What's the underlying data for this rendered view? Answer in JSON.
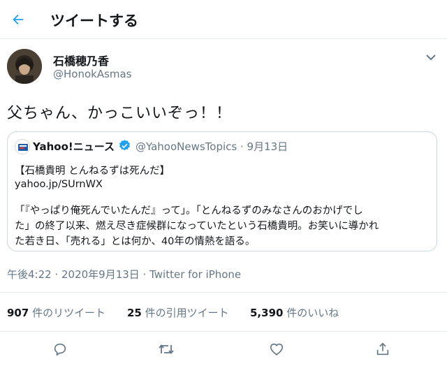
{
  "header": {
    "title": "ツイートする",
    "back_icon": "arrow-left-icon"
  },
  "author": {
    "name": "石橋穂乃香",
    "handle": "@HonokAsmas",
    "menu_icon": "chevron-down-icon"
  },
  "tweet": {
    "text": "父ちゃん、かっこいいぞっ！！"
  },
  "quote": {
    "name": "Yahoo!ニュース",
    "meta": "@YahooNewsTopics · 9月13日",
    "lines": [
      "【石橋貴明 とんねるずは死んだ】",
      "yahoo.jp/SUrnWX",
      "「『やっぱり俺死んでいたんだ』って」。「とんねるずのみなさんのおかげでし",
      "た」の終了以来、燃え尽き症候群になっていたという石橋貴明。お笑いに導かれ",
      "た若き日、「売れる」とは何か、40年の情熱を語る。"
    ]
  },
  "timestamp": "午後4:22 · 2020年9月13日 · Twitter for iPhone",
  "stats": {
    "retweets": {
      "count": "907",
      "label": "件のリツイート"
    },
    "quotes": {
      "count": "25",
      "label": "件の引用ツイート"
    },
    "likes": {
      "count": "5,390",
      "label": "件のいいね"
    }
  },
  "colors": {
    "accent": "#1da1f2",
    "text": "#14171a",
    "muted": "#657786",
    "border": "#ccd6dd"
  }
}
